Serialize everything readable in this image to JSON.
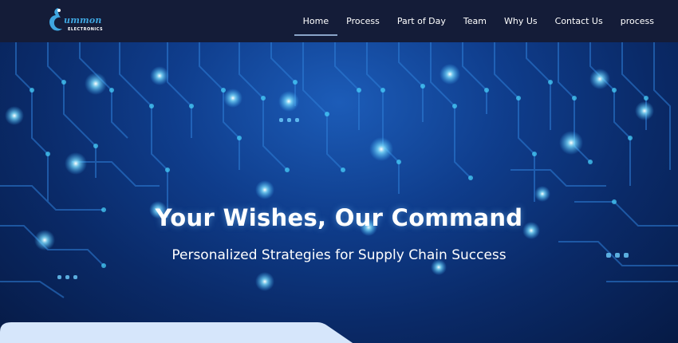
{
  "logo": {
    "brand": "ummon",
    "subtitle": "ELECTRONICS"
  },
  "nav": {
    "items": [
      {
        "label": "Home",
        "active": true
      },
      {
        "label": "Process"
      },
      {
        "label": "Part of Day"
      },
      {
        "label": "Team"
      },
      {
        "label": "Why Us"
      },
      {
        "label": "Contact Us"
      },
      {
        "label": "process"
      }
    ]
  },
  "hero": {
    "headline": "Your Wishes, Our Command",
    "subheadline": "Personalized Strategies for Supply Chain Success"
  },
  "colors": {
    "nav_bg": "#141c38",
    "brand_blue": "#3fa6e0",
    "card_bg": "#d6e6fb"
  }
}
